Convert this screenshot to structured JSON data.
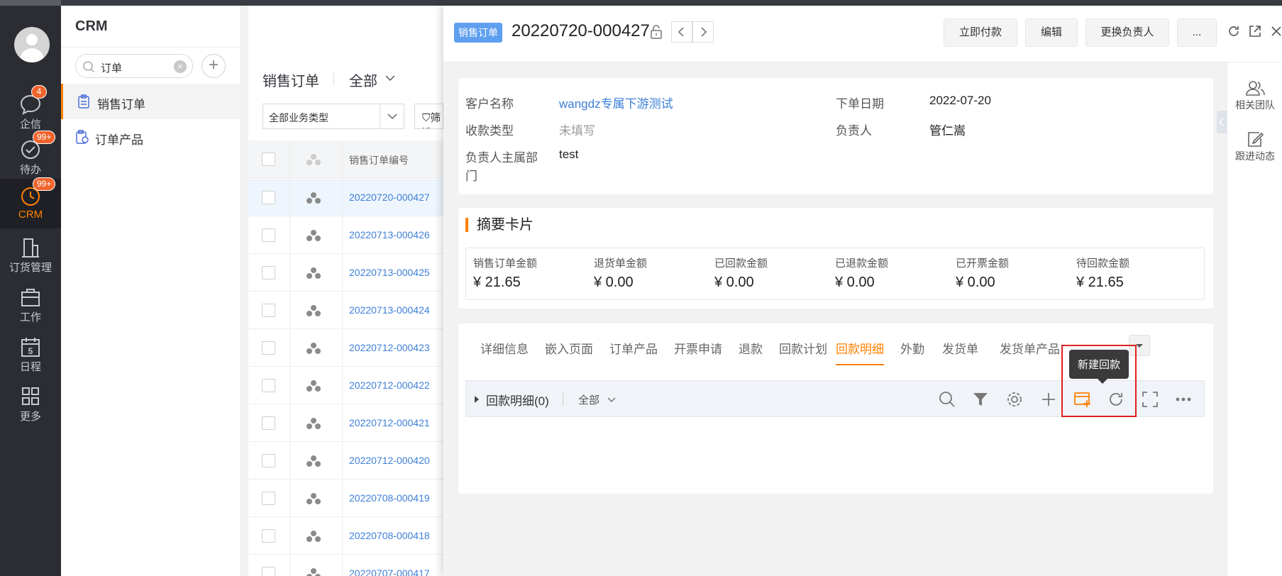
{
  "rail": {
    "items": [
      {
        "label": "企信",
        "badge": "4"
      },
      {
        "label": "待办",
        "badge": "99+"
      },
      {
        "label": "CRM",
        "badge": "99+"
      },
      {
        "label": "订货管理"
      },
      {
        "label": "工作"
      },
      {
        "label": "日程",
        "icon_text": "5"
      },
      {
        "label": "更多"
      }
    ]
  },
  "sidebar": {
    "title": "CRM",
    "search_value": "订单",
    "items": [
      {
        "label": "销售订单"
      },
      {
        "label": "订单产品"
      }
    ]
  },
  "list": {
    "title": "销售订单",
    "scope": "全部",
    "type_select": "全部业务类型",
    "filter_label": "筛选",
    "column_header": "销售订单编号",
    "rows": [
      "20220720-000427",
      "20220713-000426",
      "20220713-000425",
      "20220713-000424",
      "20220712-000423",
      "20220712-000422",
      "20220712-000421",
      "20220712-000420",
      "20220708-000419",
      "20220708-000418",
      "20220707-000417"
    ]
  },
  "detail": {
    "tag": "销售订单",
    "title": "20220720-000427",
    "buttons": {
      "pay": "立即付款",
      "edit": "编辑",
      "change_owner": "更换负责人",
      "more": "..."
    },
    "info": {
      "customer_label": "客户名称",
      "customer_value": "wangdz专属下游测试",
      "order_date_label": "下单日期",
      "order_date_value": "2022-07-20",
      "payment_type_label": "收款类型",
      "payment_type_value": "未填写",
      "owner_label": "负责人",
      "owner_value": "管仁嵩",
      "dept_label_1": "负责人主属部",
      "dept_label_2": "门",
      "dept_value": "test"
    },
    "summary": {
      "title": "摘要卡片",
      "metrics": [
        {
          "label": "销售订单金额",
          "value": "¥ 21.65"
        },
        {
          "label": "退货单金额",
          "value": "¥ 0.00"
        },
        {
          "label": "已回款金额",
          "value": "¥ 0.00"
        },
        {
          "label": "已退款金额",
          "value": "¥ 0.00"
        },
        {
          "label": "已开票金额",
          "value": "¥ 0.00"
        },
        {
          "label": "待回款金额",
          "value": "¥ 21.65"
        }
      ]
    },
    "tabs": [
      "详细信息",
      "嵌入页面",
      "订单产品",
      "开票申请",
      "退款",
      "回款计划",
      "回款明细",
      "外勤",
      "发货单",
      "发货单产品"
    ],
    "active_tab": "回款明细",
    "subpanel": {
      "caption": "回款明细(0)",
      "scope": "全部",
      "tooltip": "新建回款"
    },
    "right_bar": [
      {
        "label": "相关团队"
      },
      {
        "label": "跟进动态"
      }
    ]
  },
  "colors": {
    "accent": "#ff8000",
    "link": "#3d7fd8",
    "tag": "#5e9fef",
    "rail": "#2b2d33"
  }
}
